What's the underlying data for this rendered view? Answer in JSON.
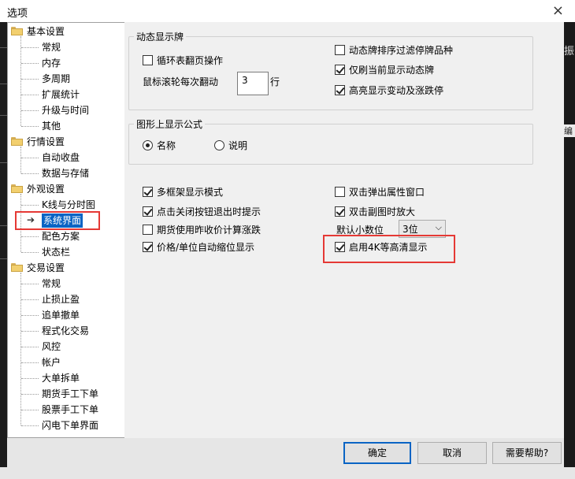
{
  "window": {
    "title": "选项",
    "close_glyph": "×"
  },
  "background_fragments": {
    "right_top": "振",
    "right_mid": "编"
  },
  "tree": {
    "groups": [
      {
        "label": "基本设置",
        "children": [
          "常规",
          "内存",
          "多周期",
          "扩展统计",
          "升级与时间",
          "其他"
        ]
      },
      {
        "label": "行情设置",
        "children": [
          "自动收盘",
          "数据与存储"
        ]
      },
      {
        "label": "外观设置",
        "children": [
          "K线与分时图",
          "系统界面",
          "配色方案",
          "状态栏"
        ]
      },
      {
        "label": "交易设置",
        "children": [
          "常规",
          "止损止盈",
          "追单撤单",
          "程式化交易",
          "风控",
          "帐户",
          "大单拆单",
          "期货手工下单",
          "股票手工下单",
          "闪电下单界面"
        ]
      }
    ],
    "selected": "系统界面"
  },
  "dynamic_board": {
    "legend": "动态显示牌",
    "loop_page_label": "循环表翻页操作",
    "loop_page_checked": false,
    "scroll_label": "鼠标滚轮每次翻动",
    "scroll_value": "3",
    "scroll_unit": "行",
    "filter_suspended_label": "动态牌排序过滤停牌品种",
    "filter_suspended_checked": false,
    "refresh_current_label": "仅刷当前显示动态牌",
    "refresh_current_checked": true,
    "highlight_change_label": "高亮显示变动及涨跌停",
    "highlight_change_checked": true
  },
  "formula": {
    "legend": "图形上显示公式",
    "option_name": "名称",
    "option_desc": "说明",
    "selected": "名称"
  },
  "misc": {
    "multi_frame_label": "多框架显示模式",
    "multi_frame_checked": true,
    "exit_prompt_label": "点击关闭按钮退出时提示",
    "exit_prompt_checked": true,
    "futures_close_label": "期货使用昨收价计算涨跌",
    "futures_close_checked": false,
    "price_shrink_label": "价格/单位自动缩位显示",
    "price_shrink_checked": true,
    "dblclick_popup_label": "双击弹出属性窗口",
    "dblclick_popup_checked": false,
    "dblclick_zoom_label": "双击副图时放大",
    "dblclick_zoom_checked": true,
    "decimals_label": "默认小数位",
    "decimals_value": "3位",
    "hd4k_label": "启用4K等高清显示",
    "hd4k_checked": true
  },
  "buttons": {
    "ok": "确定",
    "cancel": "取消",
    "help": "需要帮助?"
  },
  "colors": {
    "selection": "#0a64c4",
    "annotation": "#e53935",
    "folder": "#f2cf6e"
  }
}
